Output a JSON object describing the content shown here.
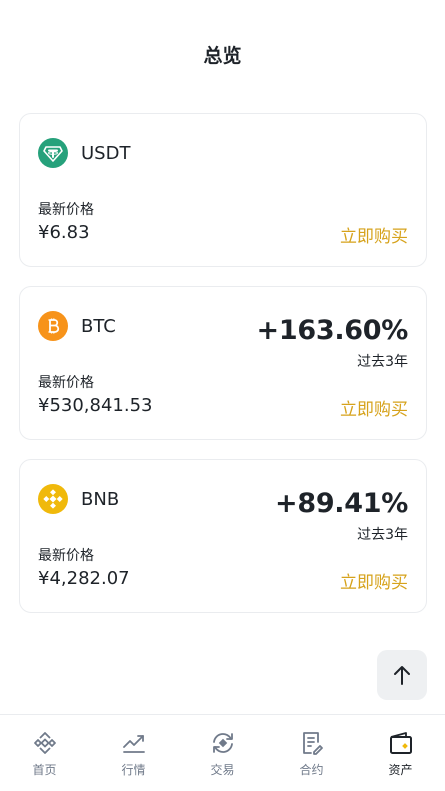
{
  "header": {
    "title": "总览"
  },
  "cards": [
    {
      "coin": "USDT",
      "icon": "tether-icon",
      "icon_color": "#26a17b",
      "change": "",
      "period": "",
      "price_label": "最新价格",
      "price": "¥6.83",
      "buy_label": "立即购买"
    },
    {
      "coin": "BTC",
      "icon": "bitcoin-icon",
      "icon_color": "#f7931a",
      "change": "+163.60%",
      "period": "过去3年",
      "price_label": "最新价格",
      "price": "¥530,841.53",
      "buy_label": "立即购买"
    },
    {
      "coin": "BNB",
      "icon": "bnb-icon",
      "icon_color": "#f0b90b",
      "change": "+89.41%",
      "period": "过去3年",
      "price_label": "最新价格",
      "price": "¥4,282.07",
      "buy_label": "立即购买"
    }
  ],
  "scroll_top": {
    "icon": "arrow-up-icon"
  },
  "tabbar": {
    "items": [
      {
        "label": "首页",
        "icon": "home-icon",
        "active": false
      },
      {
        "label": "行情",
        "icon": "markets-icon",
        "active": false
      },
      {
        "label": "交易",
        "icon": "trade-icon",
        "active": false
      },
      {
        "label": "合约",
        "icon": "futures-icon",
        "active": false
      },
      {
        "label": "资产",
        "icon": "wallet-icon",
        "active": true
      }
    ]
  },
  "colors": {
    "accent": "#d6a21b",
    "brand_yellow": "#f0b90b",
    "text": "#1e2329",
    "muted": "#707a8a",
    "border": "#eaecef"
  }
}
